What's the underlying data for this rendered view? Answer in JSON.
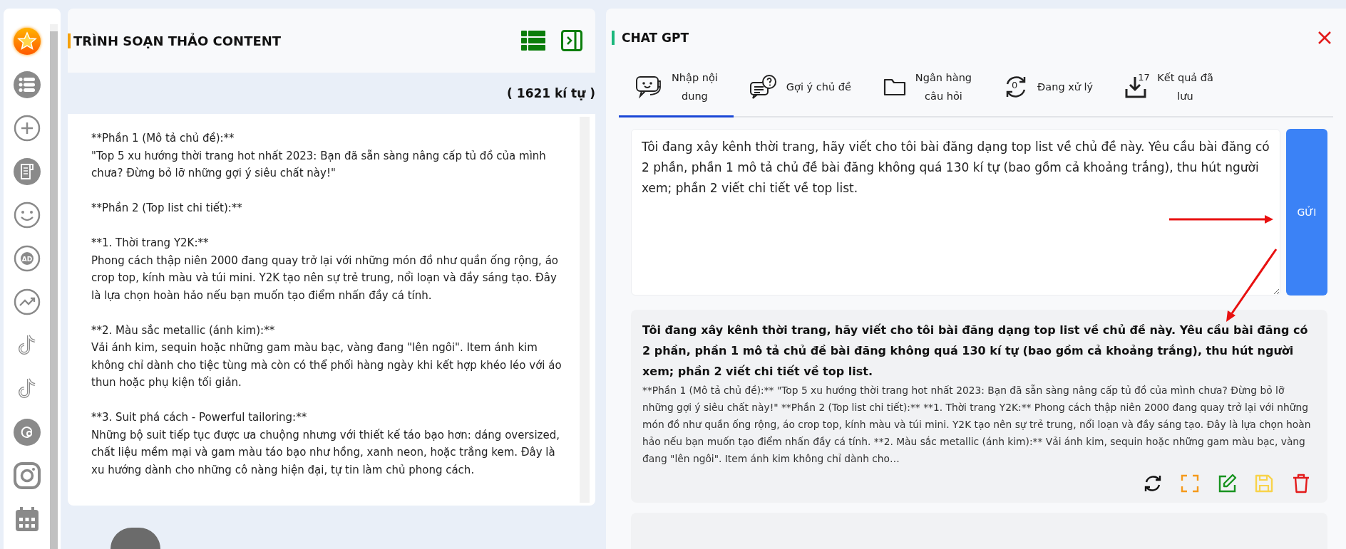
{
  "sidebar": {
    "items": [
      {
        "selected": true
      },
      {
        "selected": false
      },
      {
        "selected": false
      },
      {
        "selected": false
      },
      {
        "selected": false
      },
      {
        "selected": false,
        "icon_text": "AD"
      },
      {
        "selected": false
      },
      {
        "selected": false
      },
      {
        "selected": false
      },
      {
        "selected": false
      },
      {
        "selected": false
      },
      {
        "selected": false
      }
    ]
  },
  "editor": {
    "title": "TRÌNH SOẠN THẢO CONTENT",
    "char_count": "( 1621 kí tự )",
    "paragraphs": [
      "**Phần 1 (Mô tả chủ đề):**\n\"Top 5 xu hướng thời trang hot nhất 2023: Bạn đã sẵn sàng nâng cấp tủ đồ của mình chưa? Đừng bỏ lỡ những gợi ý siêu chất này!\"",
      "**Phần 2 (Top list chi tiết):**",
      "**1. Thời trang Y2K:**\nPhong cách thập niên 2000 đang quay trở lại với những món đồ như quần ống rộng, áo crop top, kính màu và túi mini. Y2K tạo nên sự trẻ trung, nổi loạn và đầy sáng tạo. Đây là lựa chọn hoàn hảo nếu bạn muốn tạo điểm nhấn đầy cá tính.",
      "**2. Màu sắc metallic (ánh kim):**\nVải ánh kim, sequin hoặc những gam màu bạc, vàng đang \"lên ngôi\". Item ánh kim không chỉ dành cho tiệc tùng mà còn có thể phối hàng ngày khi kết hợp khéo léo với áo thun hoặc phụ kiện tối giản.",
      "**3. Suit phá cách - Powerful tailoring:**\nNhững bộ suit tiếp tục được ưa chuộng nhưng với thiết kế táo bạo hơn: dáng oversized, chất liệu mềm mại và gam màu táo bạo như hồng, xanh neon, hoặc trắng kem. Đây là xu hướng dành cho những cô nàng hiện đại, tự tin làm chủ phong cách."
    ]
  },
  "chat": {
    "title": "CHAT GPT",
    "tabs": [
      {
        "label": "Nhập nội\ndung",
        "selected": true
      },
      {
        "label": "Gợi ý chủ đề",
        "selected": false
      },
      {
        "label": "Ngân hàng\ncâu hỏi",
        "selected": false
      },
      {
        "label": "Đang xử lý",
        "badge": "0",
        "selected": false
      },
      {
        "label": "Kết quả đã\nlưu",
        "badge": "17",
        "selected": false
      }
    ],
    "prompt": {
      "value": "Tôi đang xây kênh thời trang, hãy viết cho tôi bài đăng dạng top list về chủ đề này. Yêu cầu bài đăng có 2 phần, phần 1 mô tả chủ đề bài đăng không quá 130 kí tự (bao gồm cả khoảng trắng), thu hút người xem; phần 2 viết chi tiết về top list."
    },
    "send_button": "GỬI",
    "results": [
      {
        "question": "Tôi đang xây kênh thời trang, hãy viết cho tôi bài đăng dạng top list về chủ đề này. Yêu cầu bài đăng có 2 phần, phần 1 mô tả chủ đề bài đăng không quá 130 kí tự (bao gồm cả khoảng trắng), thu hút người xem; phần 2 viết chi tiết về top list.",
        "answer": "**Phần 1 (Mô tả chủ đề):** \"Top 5 xu hướng thời trang hot nhất 2023: Bạn đã sẵn sàng nâng cấp tủ đồ của mình chưa? Đừng bỏ lỡ những gợi ý siêu chất này!\" **Phần 2 (Top list chi tiết):** **1. Thời trang Y2K:** Phong cách thập niên 2000 đang quay trở lại với những món đồ như quần ống rộng, áo crop top, kính màu và túi mini. Y2K tạo nên sự trẻ trung, nổi loạn và đầy sáng tạo. Đây là lựa chọn hoàn hảo nếu bạn muốn tạo điểm nhấn đầy cá tính. **2. Màu sắc metallic (ánh kim):** Vải ánh kim, sequin hoặc những gam màu bạc, vàng đang \"lên ngôi\". Item ánh kim không chỉ dành cho…"
      }
    ]
  }
}
